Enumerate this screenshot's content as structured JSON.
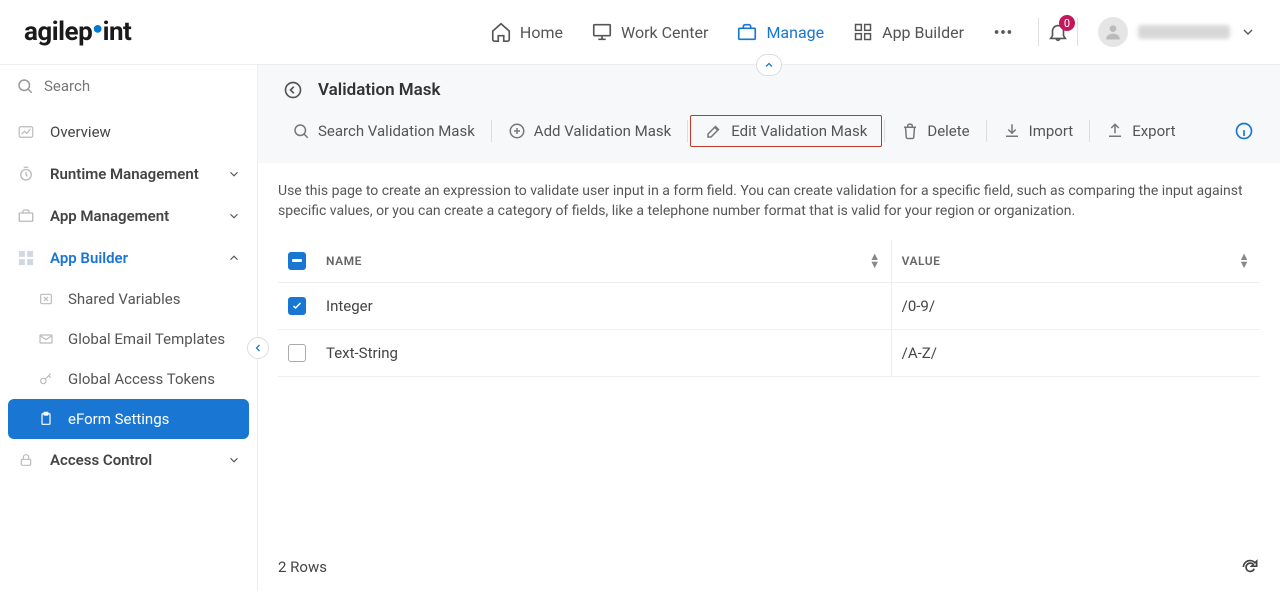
{
  "header": {
    "logo_text": "agilepoint",
    "nav": [
      {
        "id": "home",
        "label": "Home"
      },
      {
        "id": "workcenter",
        "label": "Work Center"
      },
      {
        "id": "manage",
        "label": "Manage",
        "active": true
      },
      {
        "id": "appbuilder",
        "label": "App Builder"
      }
    ],
    "notifications_count": "0"
  },
  "sidebar": {
    "search_placeholder": "Search",
    "items": [
      {
        "id": "overview",
        "label": "Overview",
        "type": "item"
      },
      {
        "id": "runtime",
        "label": "Runtime Management",
        "type": "section",
        "expandable": true,
        "expanded": false
      },
      {
        "id": "appmgmt",
        "label": "App Management",
        "type": "section",
        "expandable": true,
        "expanded": false
      },
      {
        "id": "appbuilder",
        "label": "App Builder",
        "type": "section",
        "expandable": true,
        "expanded": true,
        "active": true,
        "children": [
          {
            "id": "sharedvars",
            "label": "Shared Variables"
          },
          {
            "id": "emailtpl",
            "label": "Global Email Templates"
          },
          {
            "id": "accesstokens",
            "label": "Global Access Tokens"
          },
          {
            "id": "eformsettings",
            "label": "eForm Settings",
            "active": true
          }
        ]
      },
      {
        "id": "accesscontrol",
        "label": "Access Control",
        "type": "section",
        "expandable": true,
        "expanded": false
      }
    ]
  },
  "page": {
    "title": "Validation Mask",
    "description": "Use this page to create an expression to validate user input in a form field. You can create validation for a specific field, such as comparing the input against specific values, or you can create a category of fields, like a telephone number format that is valid for your region or organization."
  },
  "toolbar": {
    "search_placeholder": "Search Validation Mask",
    "add_label": "Add Validation Mask",
    "edit_label": "Edit Validation Mask",
    "delete_label": "Delete",
    "import_label": "Import",
    "export_label": "Export"
  },
  "table": {
    "columns": {
      "name": "NAME",
      "value": "VALUE"
    },
    "rows": [
      {
        "checked": true,
        "name": "Integer",
        "value": "/0-9/"
      },
      {
        "checked": false,
        "name": "Text-String",
        "value": "/A-Z/"
      }
    ],
    "footer": "2 Rows"
  }
}
